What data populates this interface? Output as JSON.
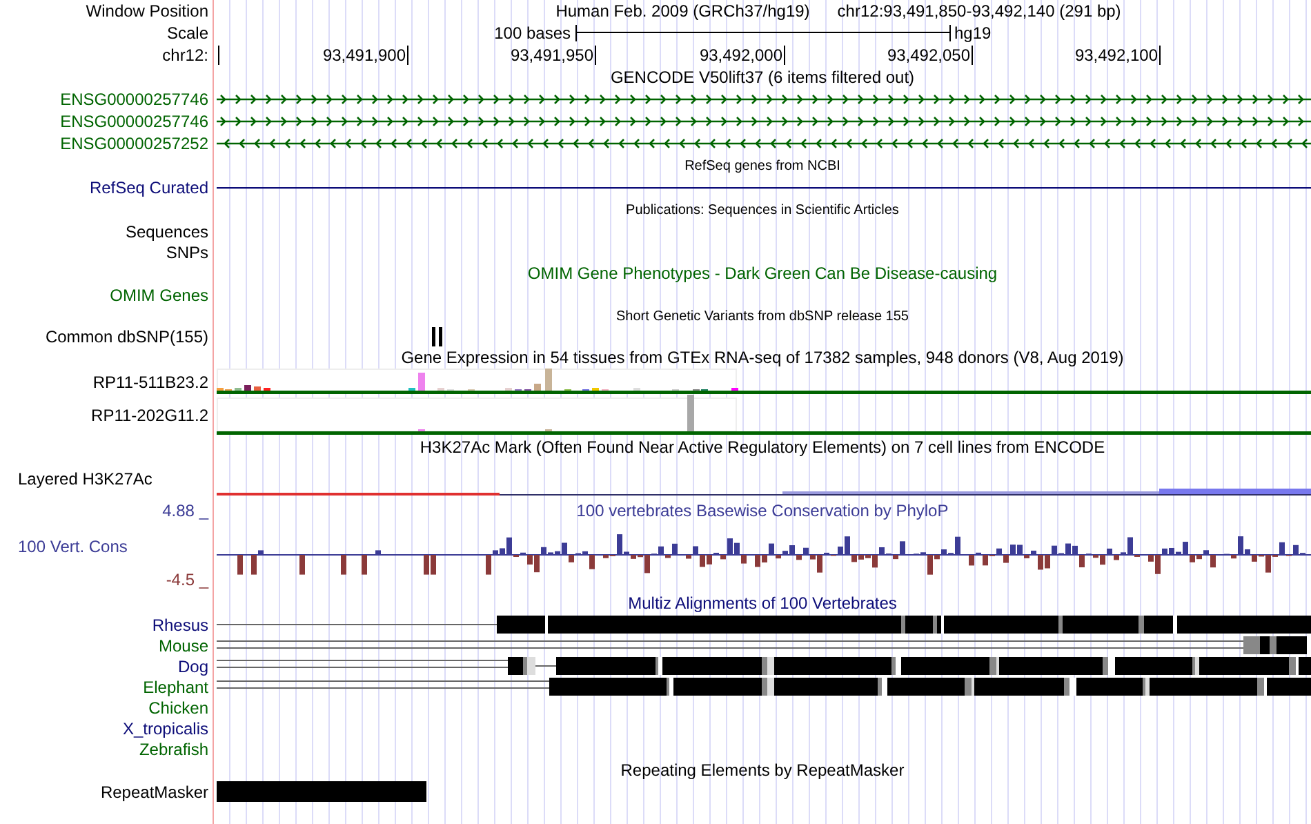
{
  "header": {
    "position_label": "Window Position",
    "assembly": "Human Feb. 2009 (GRCh37/hg19)",
    "position": "chr12:93,491,850-93,492,140 (291 bp)",
    "scale_label": "Scale",
    "scale_text": "100 bases",
    "scale_db": "hg19",
    "chrom_label": "chr12:",
    "ticks": [
      "93,491,900",
      "93,491,950",
      "93,492,000",
      "93,492,050",
      "93,492,100"
    ]
  },
  "tracks": [
    {
      "kind": "caption",
      "text": "GENCODE V50lift37 (6 items filtered out)",
      "color": "#000000"
    },
    {
      "kind": "gene",
      "label": "ENSG00000257746",
      "color": "#006400",
      "reverse": false
    },
    {
      "kind": "gene",
      "label": "ENSG00000257746",
      "color": "#006400",
      "reverse": false
    },
    {
      "kind": "gene",
      "label": "ENSG00000257252",
      "color": "#006400",
      "reverse": true
    },
    {
      "kind": "note",
      "text": "RefSeq genes from NCBI"
    },
    {
      "kind": "line",
      "label": "RefSeq Curated",
      "color": "#0c0c78"
    },
    {
      "kind": "note",
      "text": "Publications: Sequences in Scientific Articles"
    },
    {
      "kind": "plain",
      "label": "Sequences",
      "color": "#000000"
    },
    {
      "kind": "plain",
      "label": "SNPs",
      "color": "#000000"
    },
    {
      "kind": "caption",
      "text": "OMIM Gene Phenotypes - Dark Green Can Be Disease-causing",
      "color": "#006400"
    },
    {
      "kind": "plain",
      "label": "OMIM Genes",
      "color": "#006400"
    },
    {
      "kind": "note",
      "text": "Short Genetic Variants from dbSNP release 155"
    },
    {
      "kind": "snp",
      "label": "Common dbSNP(155)",
      "color": "#000000"
    },
    {
      "kind": "caption",
      "text": "Gene Expression in 54 tissues from GTEx RNA-seq of 17382 samples, 948 donors (V8, Aug 2019)",
      "color": "#000000"
    },
    {
      "kind": "expression",
      "label": "RP11-511B23.2",
      "color": "#000000"
    },
    {
      "kind": "expression",
      "label": "RP11-202G11.2",
      "color": "#000000"
    },
    {
      "kind": "caption",
      "text": "H3K27Ac Mark (Often Found Near Active Regulatory Elements) on 7 cell lines from ENCODE",
      "color": "#000000"
    },
    {
      "kind": "signal",
      "label": "Layered H3K27Ac",
      "color": "#000000"
    },
    {
      "kind": "conservation",
      "title": "100 vertebrates Basewise Conservation by PhyloP",
      "label": "100 Vert. Cons",
      "max_label": "4.88 _",
      "min_label": "-4.5 _",
      "color": "#3c3c96"
    },
    {
      "kind": "caption",
      "text": "Multiz Alignments of 100 Vertebrates",
      "color": "#0c0c78"
    },
    {
      "kind": "alignment",
      "label": "Rhesus",
      "color": "#0c0c78"
    },
    {
      "kind": "alignment",
      "label": "Mouse",
      "color": "#006400"
    },
    {
      "kind": "alignment",
      "label": "Dog",
      "color": "#0c0c78"
    },
    {
      "kind": "alignment",
      "label": "Elephant",
      "color": "#006400"
    },
    {
      "kind": "alignment",
      "label": "Chicken",
      "color": "#006400"
    },
    {
      "kind": "alignment",
      "label": "X_tropicalis",
      "color": "#0c0c78"
    },
    {
      "kind": "alignment",
      "label": "Zebrafish",
      "color": "#006400"
    },
    {
      "kind": "caption",
      "text": "Repeating Elements by RepeatMasker",
      "color": "#000000"
    },
    {
      "kind": "repeat",
      "label": "RepeatMasker",
      "color": "#000000"
    }
  ]
}
